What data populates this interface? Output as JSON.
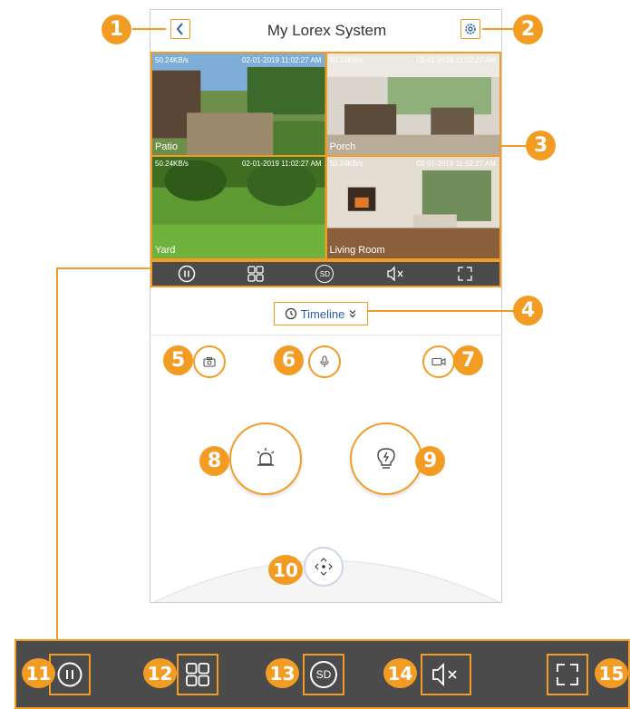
{
  "header": {
    "title": "My Lorex System"
  },
  "cameras": [
    {
      "name": "Patio",
      "rate": "50.24KB/s",
      "timestamp": "02-01-2019 11:02:27 AM"
    },
    {
      "name": "Porch",
      "rate": "50.24KB/s",
      "timestamp": "02-01-2019 11:02:27 AM"
    },
    {
      "name": "Yard",
      "rate": "50.24KB/s",
      "timestamp": "02-01-2019 11:02:27 AM"
    },
    {
      "name": "Living Room",
      "rate": "50.24KB/s",
      "timestamp": "02-01-2019 11:02:27 AM"
    }
  ],
  "toolbar": {
    "sd_label": "SD"
  },
  "timeline": {
    "label": "Timeline"
  },
  "callouts": [
    "1",
    "2",
    "3",
    "4",
    "5",
    "6",
    "7",
    "8",
    "9",
    "10",
    "11",
    "12",
    "13",
    "14",
    "15"
  ],
  "icons": [
    "back-icon",
    "gear-icon",
    "pause-icon",
    "grid-icon",
    "sd-icon",
    "mute-icon",
    "fullscreen-icon",
    "history-icon",
    "chevron-double-down-icon",
    "camera-icon",
    "microphone-icon",
    "record-icon",
    "siren-icon",
    "light-bulb-icon",
    "ptz-icon"
  ],
  "colors": {
    "accent": "#f39c24",
    "toolbar_bg": "#4b4b4b",
    "link": "#2d5ea8"
  }
}
